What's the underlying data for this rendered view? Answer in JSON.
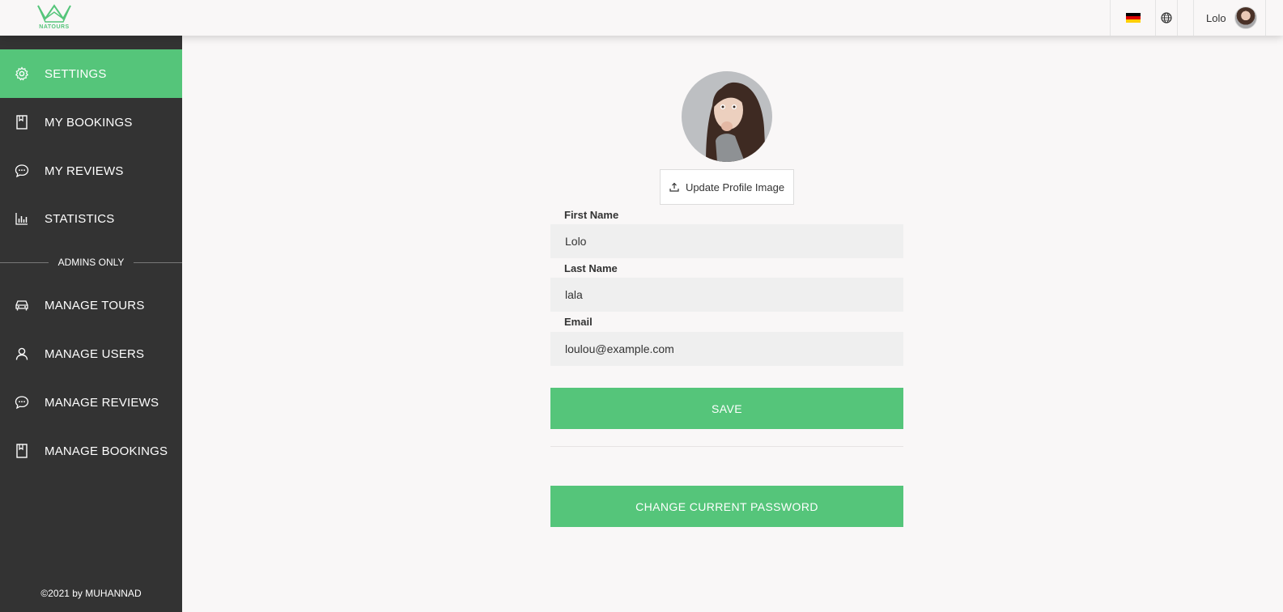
{
  "header": {
    "logo_text": "NATOURS",
    "logo_icon": "crown-icon",
    "language_flag": "german-flag-icon",
    "language_icon": "globe-icon",
    "user_name": "Lolo"
  },
  "sidebar": {
    "items": [
      {
        "label": "SETTINGS",
        "icon": "gear-icon",
        "active": true
      },
      {
        "label": "MY BOOKINGS",
        "icon": "bookmark-icon"
      },
      {
        "label": "MY REVIEWS",
        "icon": "chat-icon"
      },
      {
        "label": "STATISTICS",
        "icon": "bar-chart-icon"
      }
    ],
    "admin_divider": "ADMINS ONLY",
    "admin_items": [
      {
        "label": "MANAGE TOURS",
        "icon": "car-icon"
      },
      {
        "label": "MANAGE USERS",
        "icon": "user-icon"
      },
      {
        "label": "MANAGE REVIEWS",
        "icon": "chat-icon"
      },
      {
        "label": "MANAGE BOOKINGS",
        "icon": "bookmark-icon"
      }
    ],
    "footer": "©2021 by MUHANNAD"
  },
  "profile": {
    "update_image_label": "Update Profile Image",
    "upload_icon": "upload-icon",
    "first_name_label": "First Name",
    "first_name_value": "Lolo",
    "last_name_label": "Last Name",
    "last_name_value": "lala",
    "email_label": "Email",
    "email_value": "loulou@example.com",
    "save_label": "SAVE",
    "change_password_label": "CHANGE CURRENT PASSWORD"
  },
  "colors": {
    "accent": "#55c57a",
    "sidebar_bg": "#333333",
    "page_bg": "#f9f7f7",
    "input_bg": "#efefef"
  }
}
